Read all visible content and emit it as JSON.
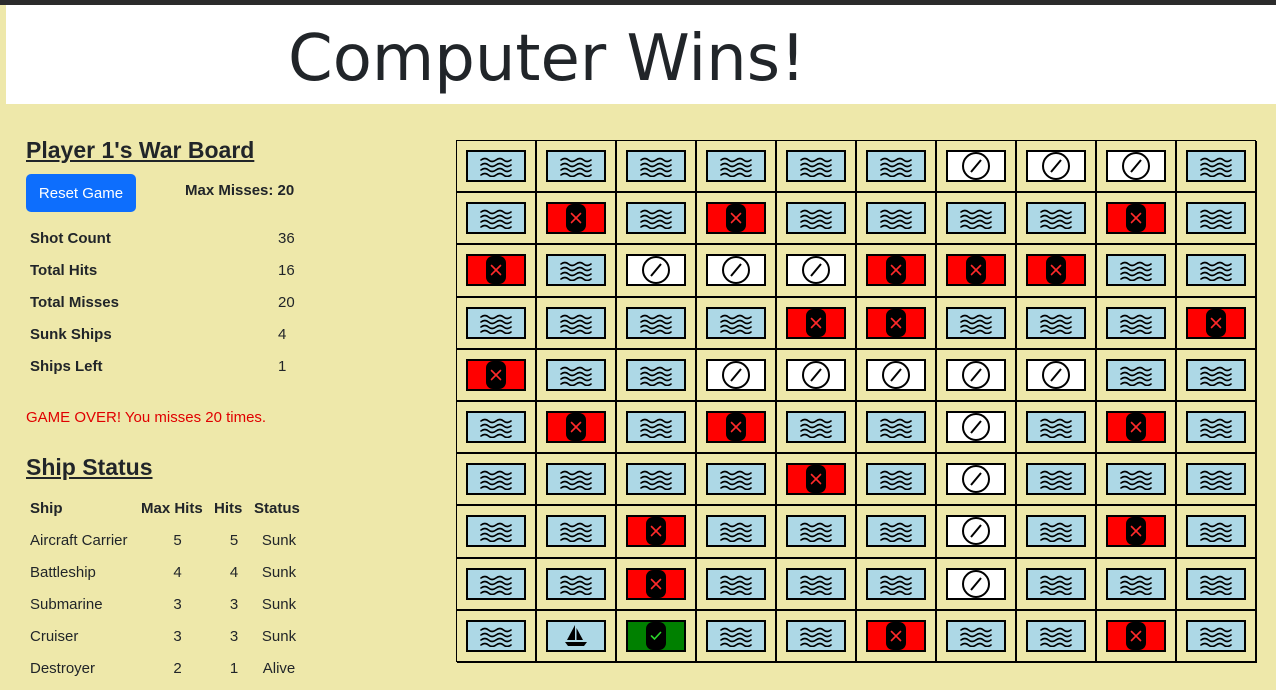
{
  "banner": {
    "title": "Computer Wins!"
  },
  "board": {
    "title": "Player 1's War Board",
    "reset_label": "Reset Game",
    "max_misses": "Max Misses: 20"
  },
  "stats": [
    {
      "label": "Shot Count",
      "value": "36"
    },
    {
      "label": "Total Hits",
      "value": "16"
    },
    {
      "label": "Total Misses",
      "value": "20"
    },
    {
      "label": "Sunk Ships",
      "value": "4"
    },
    {
      "label": "Ships Left",
      "value": "1"
    }
  ],
  "message": "GAME OVER! You misses 20 times.",
  "ship_status": {
    "title": "Ship Status",
    "headers": [
      "Ship",
      "Max Hits",
      "Hits",
      "Status"
    ],
    "rows": [
      [
        "Aircraft Carrier",
        "5",
        "5",
        "Sunk"
      ],
      [
        "Battleship",
        "4",
        "4",
        "Sunk"
      ],
      [
        "Submarine",
        "3",
        "3",
        "Sunk"
      ],
      [
        "Cruiser",
        "3",
        "3",
        "Sunk"
      ],
      [
        "Destroyer",
        "2",
        "1",
        "Alive"
      ]
    ]
  },
  "grid_legend": {
    "W": "water-tile (waves icon)",
    "M": "miss-tile (circle-slash icon)",
    "H": "hit-tile (x icon)",
    "S": "ship-tile (sailboat icon)",
    "G": "sunk-tile (check icon)"
  },
  "colors": {
    "background": "#eee8aa",
    "water": "#add8e6",
    "hit": "#ff0000",
    "miss": "#ffffff",
    "ship_marker": "#008000",
    "button": "#0d6efd",
    "alert_text": "#e00000"
  },
  "grid": [
    [
      "W",
      "W",
      "W",
      "W",
      "W",
      "W",
      "M",
      "M",
      "M",
      "W"
    ],
    [
      "W",
      "H",
      "W",
      "H",
      "W",
      "W",
      "W",
      "W",
      "H",
      "W"
    ],
    [
      "H",
      "W",
      "M",
      "M",
      "M",
      "H",
      "H",
      "H",
      "W",
      "W"
    ],
    [
      "W",
      "W",
      "W",
      "W",
      "H",
      "H",
      "W",
      "W",
      "W",
      "H"
    ],
    [
      "H",
      "W",
      "W",
      "M",
      "M",
      "M",
      "M",
      "M",
      "W",
      "W"
    ],
    [
      "W",
      "H",
      "W",
      "H",
      "W",
      "W",
      "M",
      "W",
      "H",
      "W"
    ],
    [
      "W",
      "W",
      "W",
      "W",
      "H",
      "W",
      "M",
      "W",
      "W",
      "W"
    ],
    [
      "W",
      "W",
      "H",
      "W",
      "W",
      "W",
      "M",
      "W",
      "H",
      "W"
    ],
    [
      "W",
      "W",
      "H",
      "W",
      "W",
      "W",
      "M",
      "W",
      "W",
      "W"
    ],
    [
      "W",
      "S",
      "G",
      "W",
      "W",
      "H",
      "W",
      "W",
      "H",
      "W"
    ]
  ]
}
